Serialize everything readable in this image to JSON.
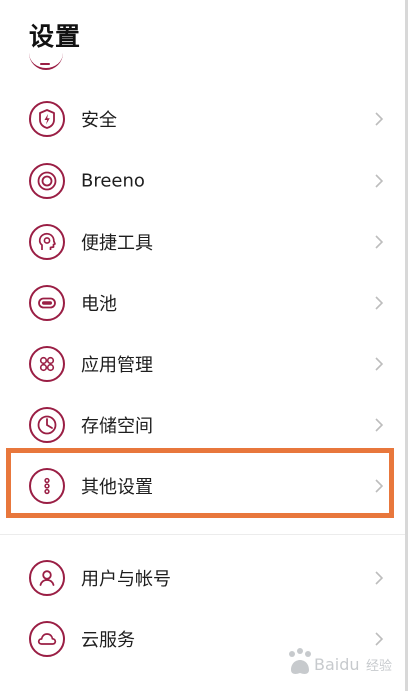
{
  "header": {
    "title": "设置"
  },
  "items": [
    {
      "label": "安全",
      "icon": "shield-bolt-icon"
    },
    {
      "label": "Breeno",
      "icon": "concentric-circles-icon"
    },
    {
      "label": "便捷工具",
      "icon": "head-gear-icon"
    },
    {
      "label": "电池",
      "icon": "battery-icon"
    },
    {
      "label": "应用管理",
      "icon": "grid-apps-icon"
    },
    {
      "label": "存储空间",
      "icon": "pie-chart-icon"
    },
    {
      "label": "其他设置",
      "icon": "more-dots-icon",
      "highlighted": true
    },
    {
      "label": "用户与帐号",
      "icon": "user-icon"
    },
    {
      "label": "云服务",
      "icon": "cloud-icon"
    }
  ],
  "colors": {
    "icon": "#9a1e44",
    "highlight": "#e8773c",
    "chevron": "#bdbdbd"
  },
  "watermark": {
    "text": "Baidu 经验"
  }
}
